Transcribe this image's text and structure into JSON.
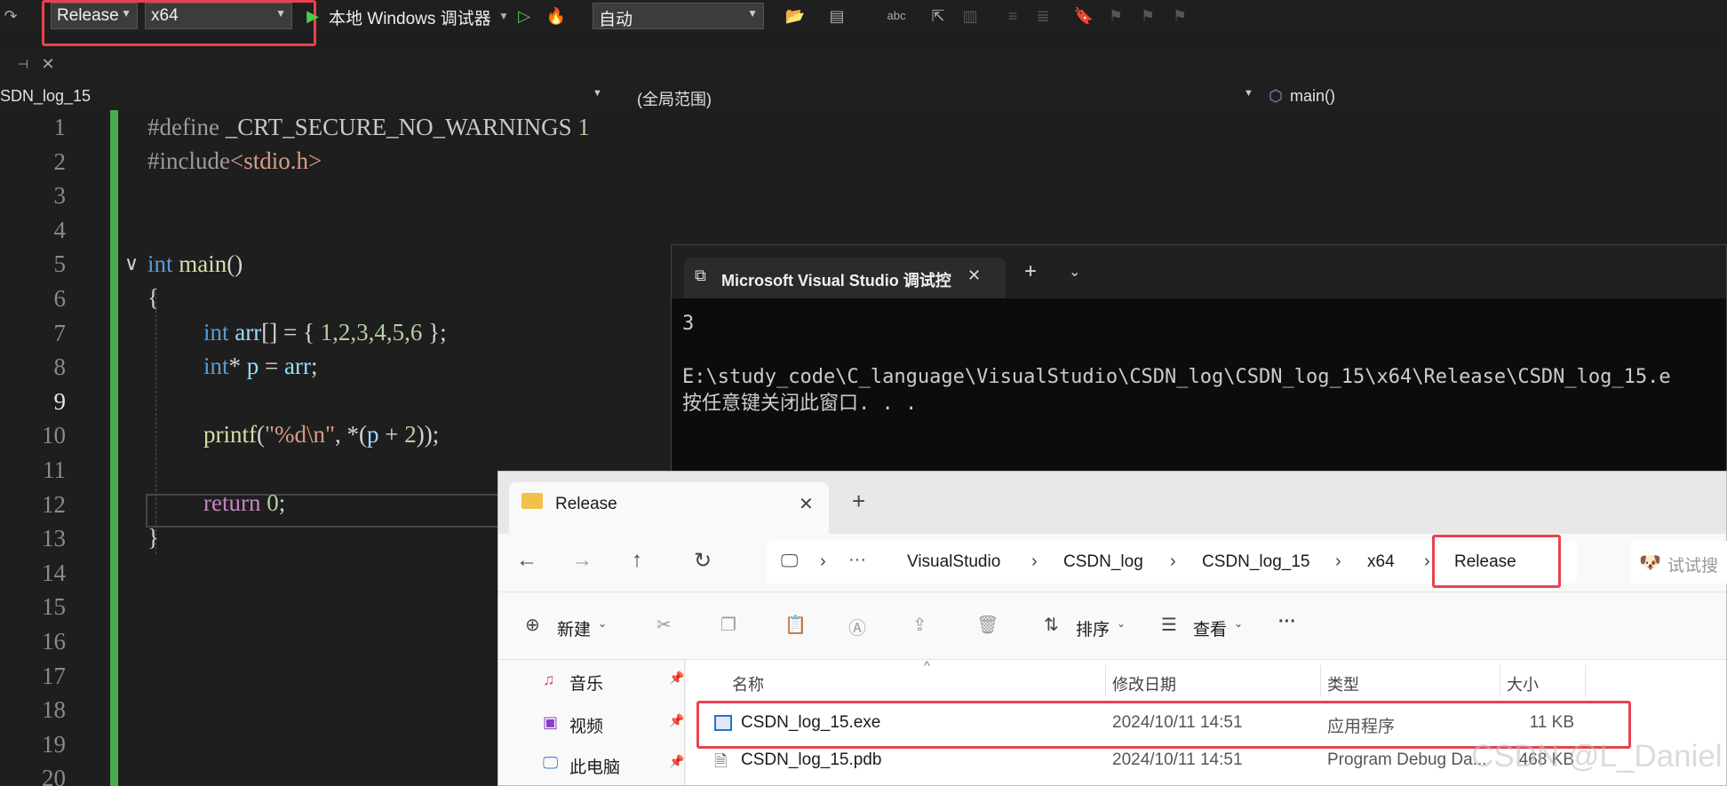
{
  "toolbar": {
    "configuration": "Release",
    "platform": "x64",
    "debugger": "本地 Windows 调试器",
    "solution_mode": "自动"
  },
  "navbar": {
    "project": "SDN_log_15",
    "scope": "(全局范围)",
    "function": "main()"
  },
  "editor": {
    "line_numbers": [
      "1",
      "2",
      "3",
      "4",
      "5",
      "6",
      "7",
      "8",
      "9",
      "10",
      "11",
      "12",
      "13",
      "14",
      "15",
      "16",
      "17",
      "18",
      "19",
      "20"
    ],
    "lines": {
      "l1_directive": "#define",
      "l1_macro": " _CRT_SECURE_NO_WARNINGS",
      "l1_value": " 1",
      "l2_directive": "#include",
      "l2_header": "<stdio.h>",
      "l5_kw": "int",
      "l5_fn": " main",
      "l5_paren": "()",
      "l6": "{",
      "l7_kw": "int",
      "l7_var": " arr",
      "l7_mid": "[] = { ",
      "l7_nums": "1,2,3,4,5,6",
      "l7_end": " };",
      "l8_kw": "int",
      "l8_star": "* ",
      "l8_var": "p",
      "l8_eq": " = ",
      "l8_var2": "arr",
      "l8_end": ";",
      "l10_fn": "printf",
      "l10_open": "(",
      "l10_str": "\"%d\\n\"",
      "l10_mid": ", *(",
      "l10_var": "p",
      "l10_plus": " + ",
      "l10_num": "2",
      "l10_end": "));",
      "l12_kw": "return",
      "l12_num": " 0",
      "l12_end": ";",
      "l13": "}"
    }
  },
  "terminal": {
    "tab_title": "Microsoft Visual Studio 调试控",
    "output_line1": "3",
    "output_line2": "E:\\study_code\\C_language\\VisualStudio\\CSDN_log\\CSDN_log_15\\x64\\Release\\CSDN_log_15.e",
    "output_line3": "按任意键关闭此窗口. . ."
  },
  "explorer": {
    "tab_title": "Release",
    "breadcrumb": [
      "VisualStudio",
      "CSDN_log",
      "CSDN_log_15",
      "x64",
      "Release"
    ],
    "search_placeholder": "试试搜",
    "cmd_new": "新建",
    "cmd_sort": "排序",
    "cmd_view": "查看",
    "sidebar": [
      "音乐",
      "视频",
      "此电脑"
    ],
    "columns": [
      "名称",
      "修改日期",
      "类型",
      "大小"
    ],
    "files": [
      {
        "name": "CSDN_log_15.exe",
        "date": "2024/10/11 14:51",
        "type": "应用程序",
        "size": "11 KB"
      },
      {
        "name": "CSDN_log_15.pdb",
        "date": "2024/10/11 14:51",
        "type": "Program Debug Da...",
        "size": "468 KB"
      }
    ]
  },
  "watermark": "CSDN @L_Daniel",
  "colors": {
    "highlight_box": "#e8424f",
    "change_bar": "#4aa84e"
  }
}
